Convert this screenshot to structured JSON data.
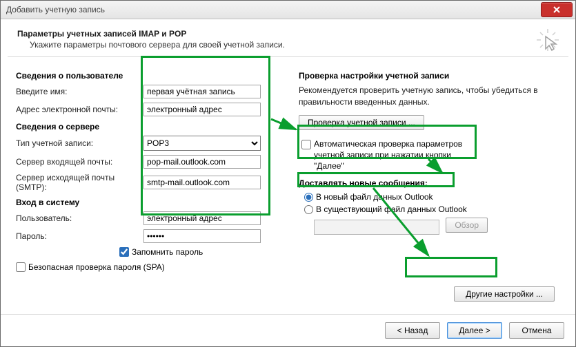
{
  "window": {
    "title": "Добавить учетную запись"
  },
  "header": {
    "title": "Параметры учетных записей IMAP и POP",
    "subtitle": "Укажите параметры почтового сервера для своей учетной записи."
  },
  "left": {
    "user_section": "Сведения о пользователе",
    "name_label": "Введите имя:",
    "name_value": "первая учётная запись",
    "email_label": "Адрес электронной почты:",
    "email_value": "электронный адрес",
    "server_section": "Сведения о сервере",
    "acct_type_label": "Тип учетной записи:",
    "acct_type_value": "POP3",
    "incoming_label": "Сервер входящей почты:",
    "incoming_value": "pop-mail.outlook.com",
    "outgoing_label": "Сервер исходящей почты (SMTP):",
    "outgoing_value": "smtp-mail.outlook.com",
    "login_section": "Вход в систему",
    "user_label": "Пользователь:",
    "user_value": "электронный адрес",
    "pass_label": "Пароль:",
    "pass_value": "******",
    "remember_label": "Запомнить пароль",
    "spa_label": "Безопасная проверка пароля (SPA)"
  },
  "right": {
    "check_section": "Проверка настройки учетной записи",
    "check_desc": "Рекомендуется проверить учетную запись, чтобы убедиться в правильности введенных данных.",
    "check_btn": "Проверка учетной записи ...",
    "auto_check_label": "Автоматическая проверка параметров учетной записи при нажатии кнопки \"Далее\"",
    "deliver_section": "Доставлять новые сообщения:",
    "radio_new": "В новый файл данных Outlook",
    "radio_existing": "В существующий файл данных Outlook",
    "browse_btn": "Обзор",
    "other_btn": "Другие настройки ..."
  },
  "footer": {
    "back": "< Назад",
    "next": "Далее >",
    "cancel": "Отмена"
  }
}
